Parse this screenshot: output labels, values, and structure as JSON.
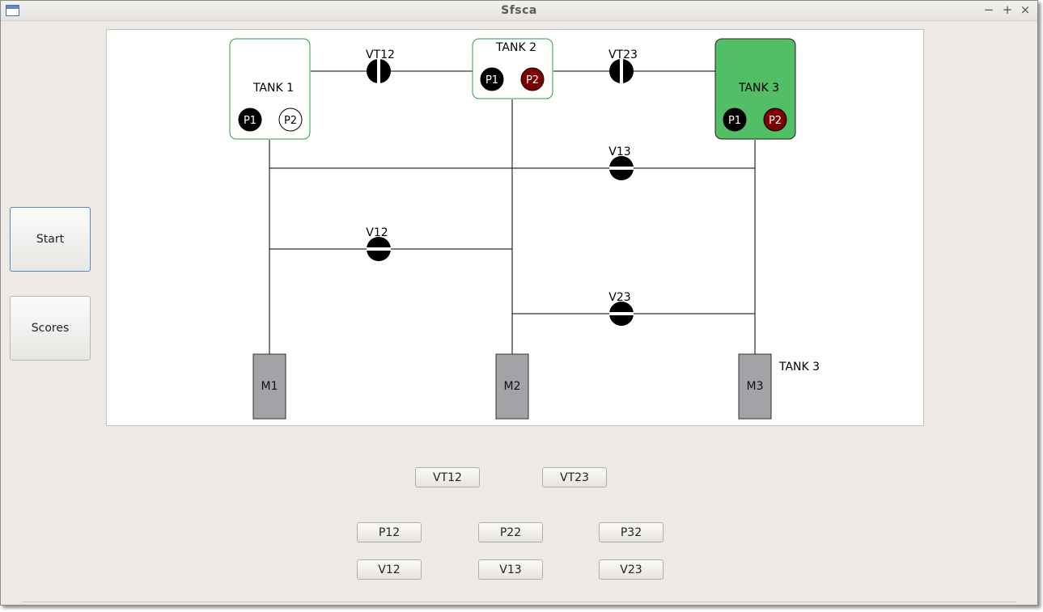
{
  "window": {
    "title": "Sfsca"
  },
  "window_controls": {
    "minimize": "−",
    "maximize": "+",
    "close": "×"
  },
  "sidebar": {
    "start_label": "Start",
    "scores_label": "Scores"
  },
  "diagram": {
    "tanks": [
      {
        "label": "TANK 1",
        "highlighted": false,
        "pumps": [
          {
            "label": "P1",
            "state": "on"
          },
          {
            "label": "P2",
            "state": "off"
          }
        ]
      },
      {
        "label": "TANK 2",
        "highlighted": false,
        "pumps": [
          {
            "label": "P1",
            "state": "on"
          },
          {
            "label": "P2",
            "state": "failed"
          }
        ]
      },
      {
        "label": "TANK 3",
        "highlighted": true,
        "pumps": [
          {
            "label": "P1",
            "state": "on"
          },
          {
            "label": "P2",
            "state": "failed"
          }
        ]
      }
    ],
    "valves": [
      {
        "label": "VT12",
        "state": "open"
      },
      {
        "label": "VT23",
        "state": "open"
      },
      {
        "label": "V13",
        "state": "closed"
      },
      {
        "label": "V12",
        "state": "closed"
      },
      {
        "label": "V23",
        "state": "closed"
      }
    ],
    "engines": [
      {
        "label": "M1"
      },
      {
        "label": "M2"
      },
      {
        "label": "M3"
      }
    ],
    "engine3_caption": "TANK 3"
  },
  "controls": {
    "vt12": "VT12",
    "vt23": "VT23",
    "p12": "P12",
    "p22": "P22",
    "p32": "P32",
    "v12": "V12",
    "v13": "V13",
    "v23": "V23"
  },
  "colors": {
    "tank_border": "#2e9a4a",
    "tank_highlight": "#52bf67",
    "pump_on": "#000000",
    "pump_failed": "#7d0000",
    "engine": "#a3a2a6"
  }
}
